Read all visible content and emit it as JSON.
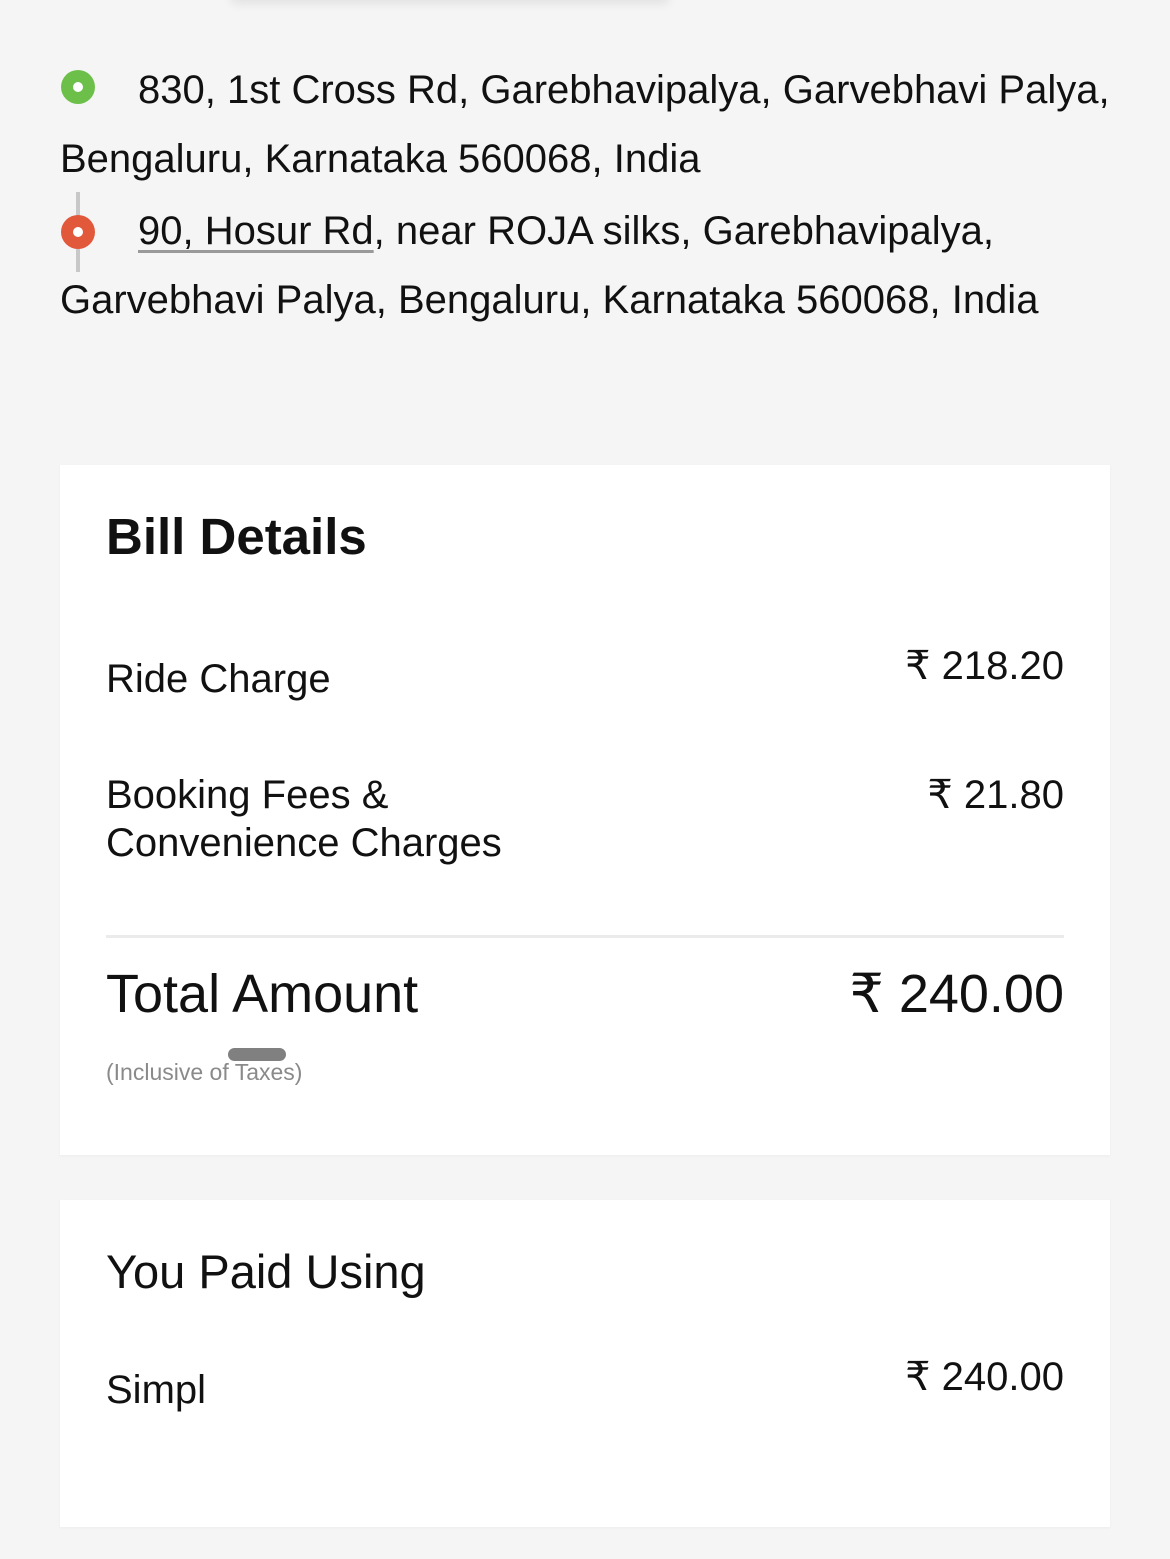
{
  "route": {
    "pickup_address": "830, 1st Cross Rd, Garebhavipalya, Garvebhavi Palya, Bengaluru, Karnataka 560068, India",
    "drop_address_link": "90, Hosur Rd",
    "drop_address_rest": ", near ROJA silks, Garebhavipalya, Garvebhavi Palya, Bengaluru, Karnataka 560068, India",
    "pickup_color": "#6cc04a",
    "drop_color": "#e2583b"
  },
  "bill": {
    "title": "Bill Details",
    "ride_charge_label": "Ride Charge",
    "ride_charge_value": "₹ 218.20",
    "fees_label_line1": "Booking Fees &",
    "fees_label_line2": "Convenience Charges",
    "fees_value": "₹ 21.80",
    "total_label": "Total Amount",
    "total_value": "₹ 240.00",
    "tax_note": "(Inclusive of Taxes)"
  },
  "payment": {
    "title": "You Paid Using",
    "method_label": "Simpl",
    "method_value": "₹ 240.00"
  }
}
